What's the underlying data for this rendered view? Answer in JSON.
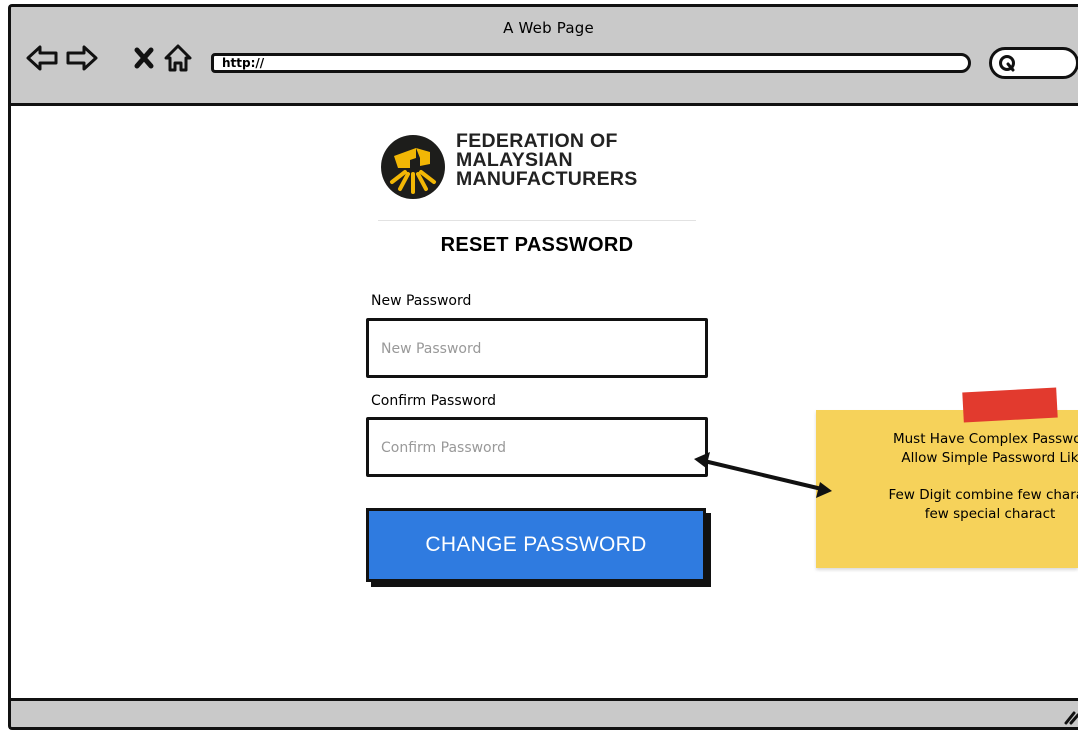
{
  "window": {
    "title": "A Web Page",
    "url": "http://"
  },
  "icons": {
    "back": "back-arrow-icon",
    "forward": "forward-arrow-icon",
    "stop": "close-icon",
    "home": "home-icon",
    "search": "search-icon",
    "resize": "resize-grip-icon"
  },
  "logo": {
    "line1": "FEDERATION OF",
    "line2": "MALAYSIAN",
    "line3": "MANUFACTURERS",
    "colors": {
      "circle": "#1d1d1b",
      "accent": "#f2b705"
    }
  },
  "form": {
    "title": "RESET PASSWORD",
    "new_password": {
      "label": "New Password",
      "placeholder": "New Password",
      "value": ""
    },
    "confirm_password": {
      "label": "Confirm Password",
      "placeholder": "Confirm Password",
      "value": ""
    },
    "submit_label": "CHANGE PASSWORD"
  },
  "note": {
    "line1": "Must Have Complex Passwor",
    "line2": "Allow Simple Password Lik",
    "line3": "Few Digit combine few charac",
    "line4": "few special charact",
    "colors": {
      "paper": "#f6d25a",
      "tape": "#e23a2e"
    }
  },
  "colors": {
    "chrome": "#c9c9c9",
    "button": "#2f7be0"
  }
}
